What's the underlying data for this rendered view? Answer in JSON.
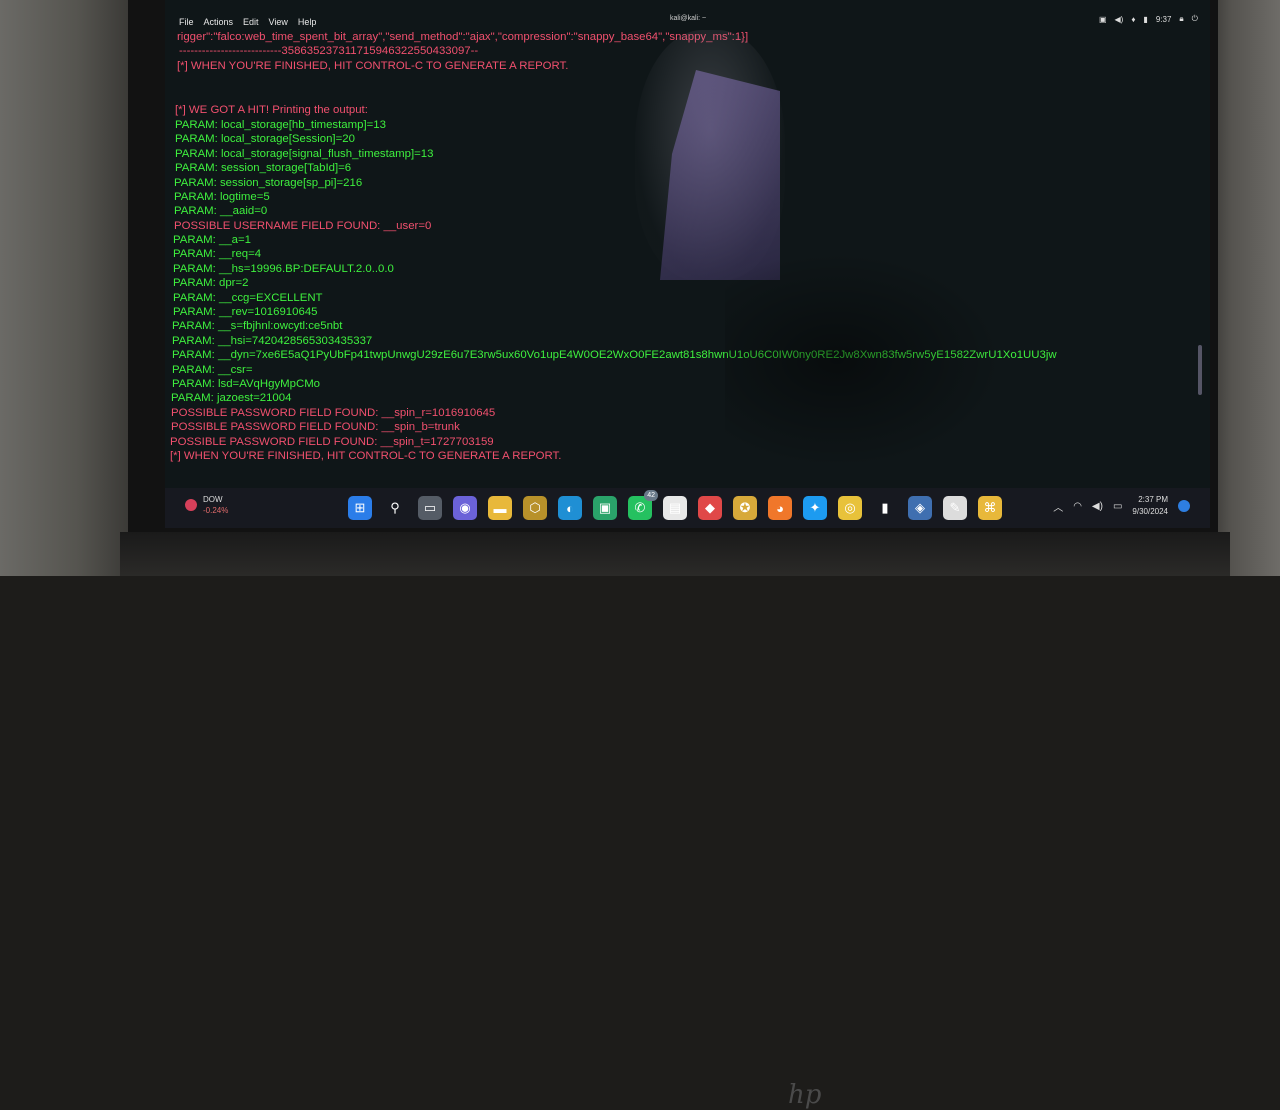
{
  "menu": [
    "File",
    "Actions",
    "Edit",
    "View",
    "Help"
  ],
  "window_title": "kali@kali: ~",
  "topbar_time": "9:37",
  "terminal_lines": [
    {
      "text": "rigger\":\"falco:web_time_spent_bit_array\",\"send_method\":\"ajax\",\"compression\":\"snappy_base64\",\"snappy_ms\":1}]",
      "color": "red"
    },
    {
      "text": "---------------------------35863523731171594632255043309​7--",
      "color": "red"
    },
    {
      "text": "[*] WHEN YOU'RE FINISHED, HIT CONTROL-C TO GENERATE A REPORT.",
      "color": "red"
    },
    {
      "text": "[*] WE GOT A HIT! Printing the output:",
      "color": "red"
    },
    {
      "text": "PARAM: local_storage[hb_timestamp]=13",
      "color": "green"
    },
    {
      "text": "PARAM: local_storage[Session]=20",
      "color": "green"
    },
    {
      "text": "PARAM: local_storage[signal_flush_timestamp]=13",
      "color": "green"
    },
    {
      "text": "PARAM: session_storage[TabId]=6",
      "color": "green"
    },
    {
      "text": "PARAM: session_storage[sp_pi]=216",
      "color": "green"
    },
    {
      "text": "PARAM: logtime=5",
      "color": "green"
    },
    {
      "text": "PARAM: __aaid=0",
      "color": "green"
    },
    {
      "text": "POSSIBLE USERNAME FIELD FOUND: __user=0",
      "color": "red"
    },
    {
      "text": "PARAM: __a=1",
      "color": "green"
    },
    {
      "text": "PARAM: __req=4",
      "color": "green"
    },
    {
      "text": "PARAM: __hs=19996.BP:DEFAULT.2.0..0.0",
      "color": "green"
    },
    {
      "text": "PARAM: dpr=2",
      "color": "green"
    },
    {
      "text": "PARAM: __ccg=EXCELLENT",
      "color": "green"
    },
    {
      "text": "PARAM: __rev=1016910645",
      "color": "green"
    },
    {
      "text": "PARAM: __s=fbjhnl:owcytl:ce5nbt",
      "color": "green"
    },
    {
      "text": "PARAM: __hsi=7420428565303435337",
      "color": "green"
    },
    {
      "text": "PARAM: __dyn=7xe6E5aQ1PyUbFp41twpUnwgU29zE6u7E3rw5ux60Vo1upE4W0OE2WxO0FE2awt81s8hwnU1oU6C0IW0ny0RE2Jw8Xwn83fw5rw5yE1582ZwrU1Xo1UU3jw",
      "color": "green"
    },
    {
      "text": "PARAM: __csr=",
      "color": "green"
    },
    {
      "text": "PARAM: lsd=AVqHgyMpCMo",
      "color": "green"
    },
    {
      "text": "PARAM: jazoest=21004",
      "color": "green"
    },
    {
      "text": "POSSIBLE PASSWORD FIELD FOUND: __spin_r=1016910645",
      "color": "red"
    },
    {
      "text": "POSSIBLE PASSWORD FIELD FOUND: __spin_b=trunk",
      "color": "red"
    },
    {
      "text": "POSSIBLE PASSWORD FIELD FOUND: __spin_t=1727703159",
      "color": "red"
    },
    {
      "text": "[*] WHEN YOU'RE FINISHED, HIT CONTROL-C TO GENERATE A REPORT.",
      "color": "red"
    }
  ],
  "widget": {
    "name": "DOW",
    "change": "-0.24%"
  },
  "taskbar_apps": [
    {
      "name": "start-icon",
      "color": "#2b7de9",
      "glyph": "⊞"
    },
    {
      "name": "search-icon",
      "color": "transparent",
      "glyph": "⚲"
    },
    {
      "name": "task-view-icon",
      "color": "#555c66",
      "glyph": "▭"
    },
    {
      "name": "chat-icon",
      "color": "#6b62d8",
      "glyph": "◉"
    },
    {
      "name": "file-explorer-icon",
      "color": "#e8b83a",
      "glyph": "▬"
    },
    {
      "name": "app-hex-icon",
      "color": "#b8912a",
      "glyph": "⬡"
    },
    {
      "name": "edge-icon",
      "color": "#1f8fd4",
      "glyph": "◐"
    },
    {
      "name": "meet-icon",
      "color": "#2aa36a",
      "glyph": "▣"
    },
    {
      "name": "whatsapp-icon",
      "color": "#25c160",
      "glyph": "✆",
      "badge": "42"
    },
    {
      "name": "clipboard-icon",
      "color": "#e8e8e8",
      "glyph": "▤"
    },
    {
      "name": "app-red-icon",
      "color": "#e04848",
      "glyph": "◆"
    },
    {
      "name": "medal-icon",
      "color": "#d7a93a",
      "glyph": "✪"
    },
    {
      "name": "firefox-icon",
      "color": "#f0772a",
      "glyph": "◕"
    },
    {
      "name": "twitter-icon",
      "color": "#1d9bf0",
      "glyph": "✦"
    },
    {
      "name": "chrome-icon",
      "color": "#e8c23a",
      "glyph": "◎"
    },
    {
      "name": "signal-bars-icon",
      "color": "transparent",
      "glyph": "▮"
    },
    {
      "name": "box-icon",
      "color": "#3f6fb0",
      "glyph": "◈"
    },
    {
      "name": "pen-icon",
      "color": "#dcdcdc",
      "glyph": "✎"
    },
    {
      "name": "kali-icon",
      "color": "#e8b83a",
      "glyph": "⌘"
    }
  ],
  "tray": {
    "time": "2:37 PM",
    "date": "9/30/2024"
  }
}
